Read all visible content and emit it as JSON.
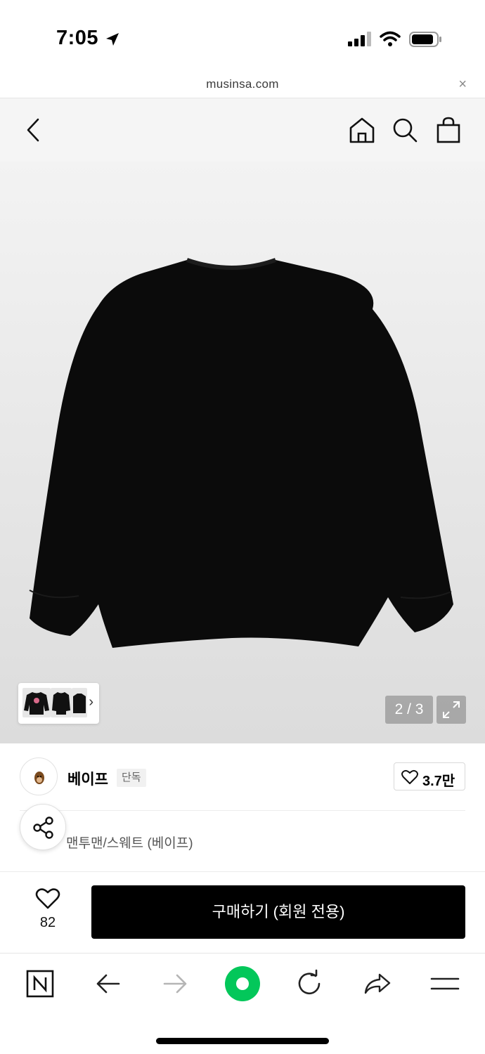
{
  "status_bar": {
    "time": "7:05",
    "location_icon": "location-arrow-icon",
    "signal_icon": "cellular-signal-icon",
    "wifi_icon": "wifi-icon",
    "battery_icon": "battery-icon"
  },
  "url_bar": {
    "url": "musinsa.com",
    "close_label": "×"
  },
  "header": {
    "back_icon": "chevron-left-icon",
    "home_icon": "home-icon",
    "search_icon": "search-icon",
    "cart_icon": "shopping-bag-icon"
  },
  "gallery": {
    "counter": "2 / 3",
    "thumb_chevron": "›",
    "expand_icon": "expand-icon"
  },
  "brand": {
    "name": "베이프",
    "badge": "단독",
    "likes": "3.7만"
  },
  "product": {
    "category": "맨투맨/스웨트 (베이프)"
  },
  "purchase": {
    "wish_count": "82",
    "buy_label": "구매하기 (회원 전용)"
  },
  "browser_toolbar": {
    "items": [
      "naver-icon",
      "back-arrow-icon",
      "forward-arrow-icon",
      "green-dot-icon",
      "reload-icon",
      "share-arrow-icon",
      "menu-icon"
    ]
  },
  "colors": {
    "buy_button": "#000000",
    "accent_green": "#03c75a",
    "gallery_bg": "#e8e8e8"
  }
}
